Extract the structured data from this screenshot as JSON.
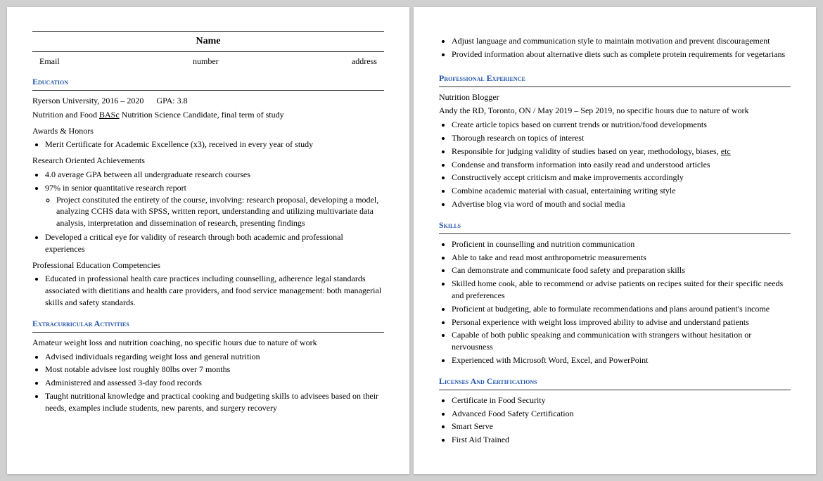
{
  "page1": {
    "header": {
      "name": "Name",
      "email": "Email",
      "number": "number",
      "address": "address"
    },
    "education": {
      "title": "Education",
      "university": "Ryerson University, 2016 – 2020",
      "gpa": "GPA: 3.8",
      "degree": "Nutrition and Food ",
      "degree_underline": "BASc",
      "degree_rest": " Nutrition Science Candidate, final term of study",
      "awards_title": "Awards & Honors",
      "awards_items": [
        "Merit Certificate for Academic Excellence (x3), received in every year of study"
      ],
      "research_title": "Research Oriented Achievements",
      "research_items": [
        "4.0 average GPA between all undergraduate research courses",
        "97% in senior quantitative research report"
      ],
      "research_sub_items": [
        "Project constituted the entirety of the course, involving: research proposal, developing a model, analyzing CCHS data with SPSS, written report, understanding and utilizing multivariate data analysis, interpretation and dissemination of research, presenting findings"
      ],
      "research_items2": [
        "Developed a critical eye for validity of research through both academic and professional experiences"
      ],
      "competencies_title": "Professional Education Competencies",
      "competencies_items": [
        "Educated in professional health care practices including counselling, adherence legal standards associated with dietitians and health care providers, and food service management: both managerial skills and safety standards."
      ]
    },
    "extracurricular": {
      "title": "Extracurricular Activities",
      "description": "Amateur weight loss and nutrition coaching, no specific hours due to nature of work",
      "items": [
        "Advised individuals regarding weight loss and general nutrition",
        "Most notable advisee lost roughly 80lbs over 7 months",
        "Administered and assessed 3-day food records",
        "Taught nutritional knowledge and practical cooking and budgeting skills to advisees based on their needs, examples include students, new parents, and surgery recovery"
      ]
    }
  },
  "page2": {
    "intro_items": [
      "Adjust language and communication style to maintain motivation and prevent discouragement",
      "Provided information about alternative diets such as complete protein requirements for vegetarians"
    ],
    "professional_experience": {
      "title": "Professional Experience",
      "job_title": "Nutrition Blogger",
      "employer": "Andy the RD, Toronto, ON / May 2019 – Sep 2019, no specific hours due to nature of work",
      "items": [
        "Create article topics based on current trends or nutrition/food developments",
        "Thorough research on topics of interest",
        "Responsible for judging validity of studies based on year, methodology, biases, etc",
        "Condense and transform information into easily read and understood articles",
        "Constructively accept criticism and make improvements accordingly",
        "Combine academic material with casual, entertaining writing style",
        "Advertise blog via word of mouth and social media"
      ],
      "etc_underline": "etc"
    },
    "skills": {
      "title": "Skills",
      "items": [
        "Proficient in counselling and nutrition communication",
        "Able to take and read most anthropometric measurements",
        "Can demonstrate and communicate food safety and preparation skills",
        "Skilled home cook, able to recommend or advise patients on recipes suited for their specific needs and preferences",
        "Proficient at budgeting, able to formulate recommendations and plans around patient's income",
        "Personal experience with weight loss improved ability to advise and understand patients",
        "Capable of both public speaking and communication with strangers without hesitation or nervousness",
        "Experienced with Microsoft Word, Excel, and PowerPoint"
      ]
    },
    "licenses": {
      "title": "Licenses and Certifications",
      "items": [
        "Certificate in Food Security",
        "Advanced Food Safety Certification",
        "Smart Serve",
        "First Aid Trained"
      ]
    }
  }
}
